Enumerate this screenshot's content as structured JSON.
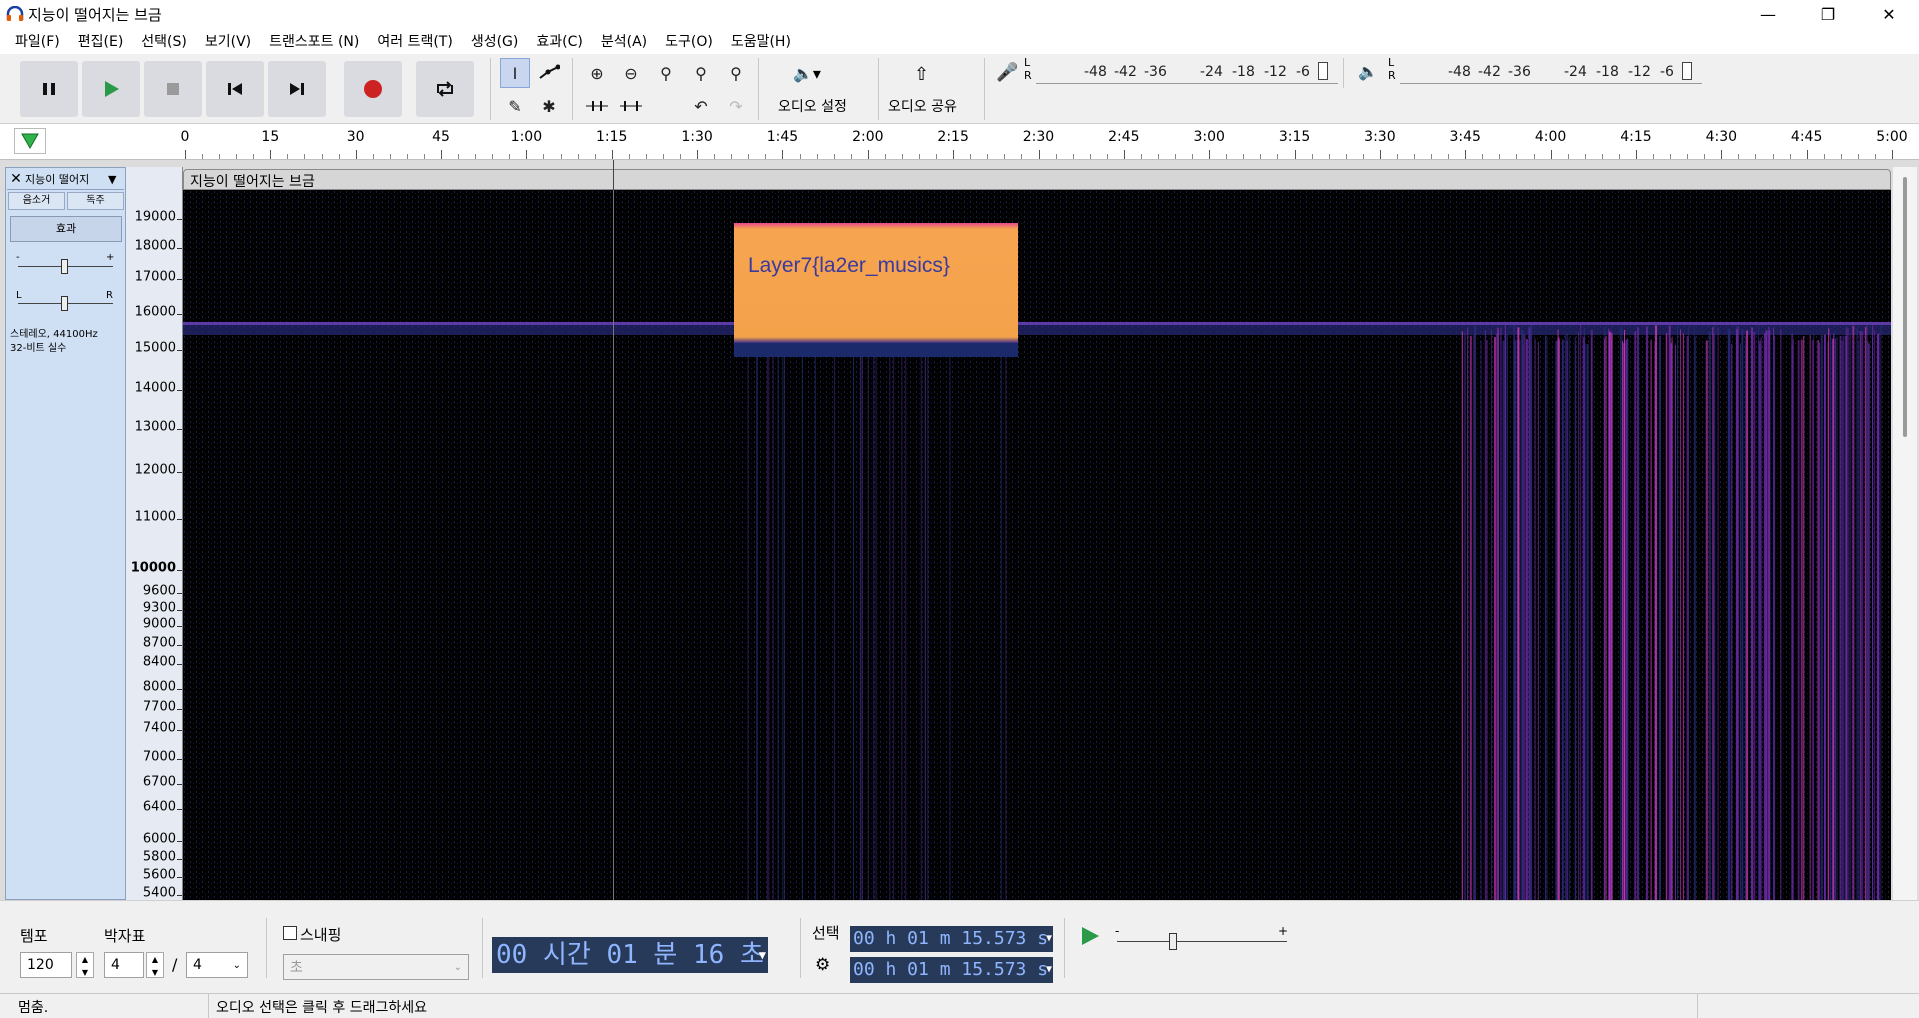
{
  "window": {
    "title": "지능이 떨어지는 브금",
    "controls": [
      "minimize-icon",
      "restore-icon",
      "close-icon"
    ]
  },
  "menu": [
    "파일(F)",
    "편집(E)",
    "선택(S)",
    "보기(V)",
    "트랜스포트 (N)",
    "여러 트랙(T)",
    "생성(G)",
    "효과(C)",
    "분석(A)",
    "도구(O)",
    "도움말(H)"
  ],
  "toolbar": {
    "audio_settings_label": "오디오 설정",
    "share_audio_label": "오디오 공유",
    "record_meter": {
      "left_right": [
        "L",
        "R"
      ],
      "scale": [
        "-48",
        "-42",
        "-36",
        "-24",
        "-18",
        "-12",
        "-6"
      ]
    },
    "play_meter": {
      "left_right": [
        "L",
        "R"
      ],
      "scale": [
        "-48",
        "-42",
        "-36",
        "-24",
        "-18",
        "-12",
        "-6"
      ]
    }
  },
  "timeline": {
    "labels": [
      "0",
      "15",
      "30",
      "45",
      "1:00",
      "1:15",
      "1:30",
      "1:45",
      "2:00",
      "2:15",
      "2:30",
      "2:45",
      "3:00",
      "3:15",
      "3:30",
      "3:45",
      "4:00",
      "4:15",
      "4:30",
      "4:45",
      "5:00"
    ]
  },
  "track": {
    "name": "지능이 떨어지",
    "mute_label": "음소거",
    "solo_label": "독주",
    "effects_label": "효과",
    "gain_min": "-",
    "gain_max": "+",
    "pan_left": "L",
    "pan_right": "R",
    "info_line1": "스테레오, 44100Hz",
    "info_line2": "32-비트 실수",
    "clip_name": "지능이 떨어지는 브금",
    "hidden_text": "Layer7{la2er_musics}"
  },
  "frequency_axis": [
    "19000",
    "18000",
    "17000",
    "16000",
    "15000",
    "14000",
    "13000",
    "12000",
    "11000",
    "10000",
    "9600",
    "9300",
    "9000",
    "8700",
    "8400",
    "8000",
    "7700",
    "7400",
    "7000",
    "6700",
    "6400",
    "6000",
    "5800",
    "5600",
    "5400"
  ],
  "bottom": {
    "tempo_label": "템포",
    "tempo_value": "120",
    "time_sig_label": "박자표",
    "time_sig_top": "4",
    "time_sig_slash": "/",
    "time_sig_bottom": "4",
    "snap_label": "스내핑",
    "snap_unit": "초",
    "time_display": "00 시간 01 분 16 초",
    "selection_label": "선택",
    "selection_start": "00 h 01 m 15.573 s",
    "selection_end": "00 h 01 m 15.573 s",
    "speed_min": "-",
    "speed_max": "+"
  },
  "status": {
    "left": "멈춤.",
    "hint": "오디오 선택은 클릭 후 드래그하세요"
  },
  "colors": {
    "accent": "#8aa6d8",
    "record": "#cc2222",
    "play": "#2b9a48",
    "spectro_band": "#f4a24a"
  }
}
